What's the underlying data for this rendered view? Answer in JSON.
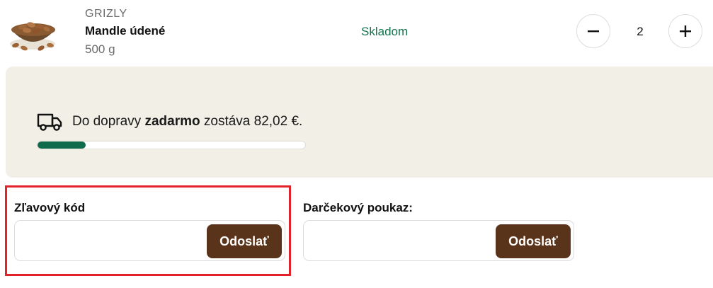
{
  "product": {
    "brand": "GRIZLY",
    "name": "Mandle údené",
    "weight": "500 g",
    "stock_status": "Skladom",
    "quantity": "2"
  },
  "shipping": {
    "text_before": "Do dopravy ",
    "text_bold": "zadarmo",
    "text_after": " zostáva 82,02 €.",
    "progress_fraction": 0.18
  },
  "discount_code": {
    "label": "Zľavový kód",
    "value": "",
    "button_label": "Odoslať"
  },
  "gift_voucher": {
    "label": "Darčekový poukaz:",
    "value": "",
    "button_label": "Odoslať"
  },
  "colors": {
    "accent_green": "#14734f",
    "button_brown": "#5a341a",
    "highlight_red": "#e2232b",
    "panel_beige": "#f1efe6"
  },
  "icons": [
    "almonds-product-image",
    "minus-icon",
    "plus-icon",
    "truck-icon"
  ]
}
